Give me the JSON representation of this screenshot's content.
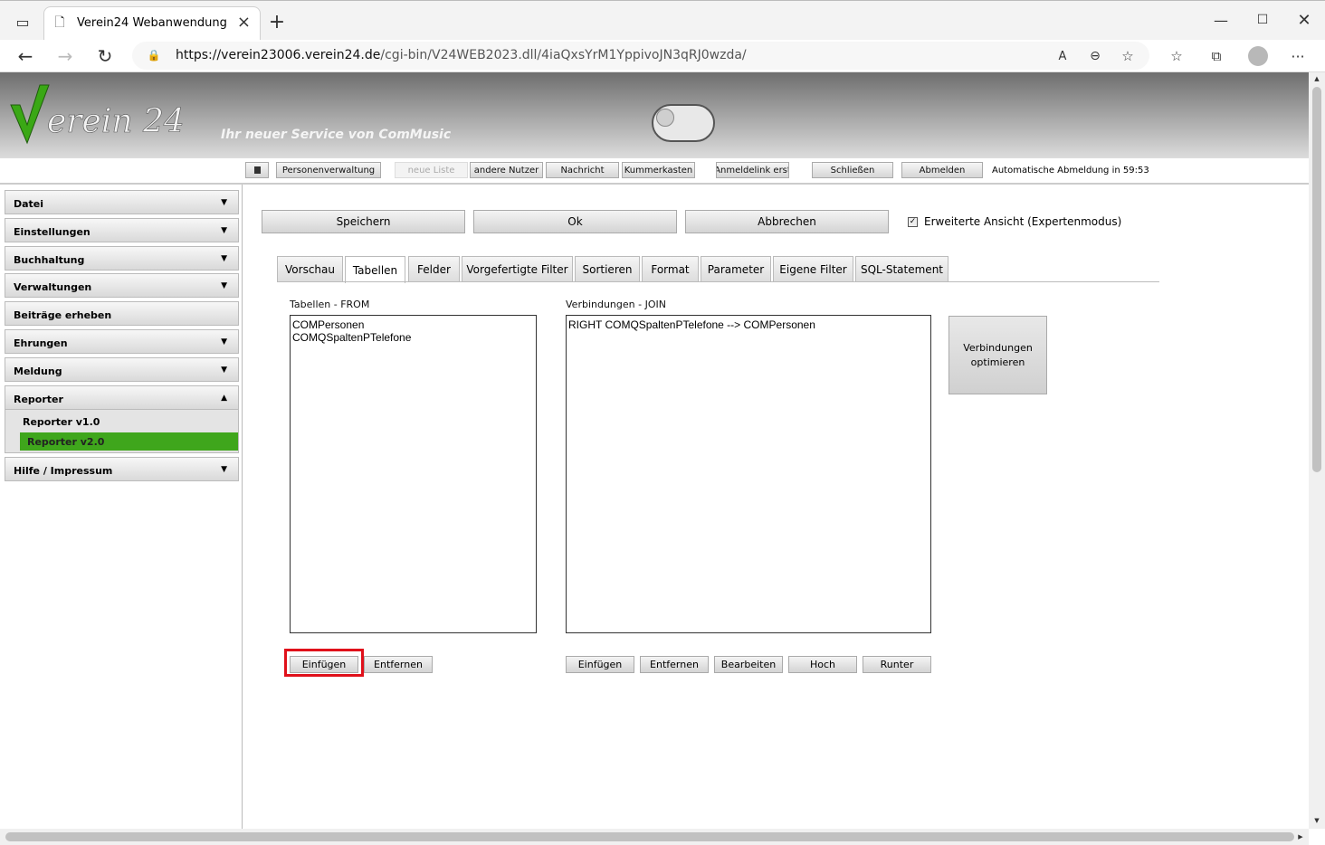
{
  "browser": {
    "tab_title": "Verein24 Webanwendung",
    "url_host": "https://verein23006.verein24.de",
    "url_path": "/cgi-bin/V24WEB2023.dll/4iaQxsYrM1YppivoJN3qRJ0wzda/"
  },
  "header": {
    "logo_text": "Verein 24",
    "slogan": "Ihr neuer Service von ComMusic"
  },
  "toolbar": {
    "items": [
      "Personenverwaltung",
      "neue Liste",
      "andere Nutzer",
      "Nachricht",
      "Kummerkasten",
      "Anmeldelink erst",
      "Schließen",
      "Abmelden"
    ],
    "auto_logout": "Automatische Abmeldung in 59:53"
  },
  "sidebar": {
    "menus": [
      "Datei",
      "Einstellungen",
      "Buchhaltung",
      "Verwaltungen",
      "Beiträge erheben",
      "Ehrungen",
      "Meldung",
      "Reporter",
      "Hilfe / Impressum"
    ],
    "reporter_items": [
      "Reporter v1.0",
      "Reporter v2.0"
    ]
  },
  "actions": {
    "save": "Speichern",
    "ok": "Ok",
    "cancel": "Abbrechen",
    "expert_mode": "Erweiterte Ansicht (Expertenmodus)"
  },
  "tabs": [
    "Vorschau",
    "Tabellen",
    "Felder",
    "Vorgefertigte Filter",
    "Sortieren",
    "Format",
    "Parameter",
    "Eigene Filter",
    "SQL-Statement"
  ],
  "tables_panel": {
    "label": "Tabellen - FROM",
    "items": [
      "COMPersonen",
      "COMQSpaltenPTelefone"
    ],
    "insert": "Einfügen",
    "remove": "Entfernen"
  },
  "joins_panel": {
    "label": "Verbindungen - JOIN",
    "items": [
      "RIGHT COMQSpaltenPTelefone --> COMPersonen"
    ],
    "insert": "Einfügen",
    "remove": "Entfernen",
    "edit": "Bearbeiten",
    "up": "Hoch",
    "down": "Runter",
    "optimize": "Verbindungen optimieren"
  },
  "colors": {
    "accent_green": "#3fa61c",
    "highlight_red": "#e0101a"
  }
}
